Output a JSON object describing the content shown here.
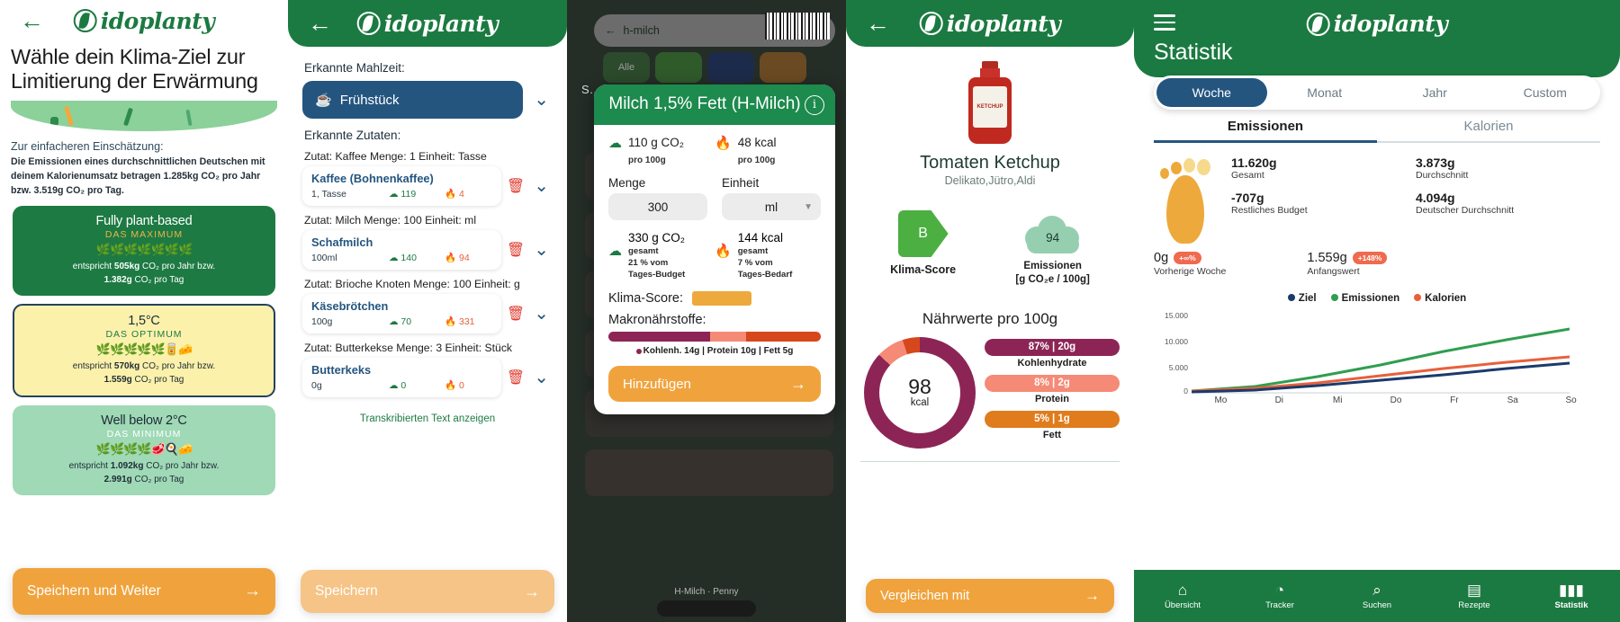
{
  "brand": {
    "name": "idoplanty",
    "leaf_icon": "leaf-circle-icon"
  },
  "panel1": {
    "back_icon": "back-arrow-icon",
    "title": "Wähle dein Klima-Ziel zur Limitierung der Erwärmung",
    "note_head": "Zur einfacheren Einschätzung:",
    "note_body": "Die Emissionen eines durchschnittlichen Deutschen mit deinem Kalorienumsatz betragen 1.285kg CO₂ pro Jahr bzw. 3.519g CO₂ pro Tag.",
    "goals": [
      {
        "title": "Fully plant-based",
        "sub": "DAS MAXIMUM",
        "icons": "🌿🌿🌿🌿🌿🌿🌿",
        "eq_prefix": "entspricht ",
        "eq_year": "505kg",
        "eq_year_suffix": " CO₂ pro Jahr bzw.",
        "eq_day": "1.382g",
        "eq_day_suffix": " CO₂ pro Tag"
      },
      {
        "title": "1,5°C",
        "sub": "DAS OPTIMUM",
        "icons": "🌿🌿🌿🌿🌿🥫🧀",
        "eq_prefix": "entspricht ",
        "eq_year": "570kg",
        "eq_year_suffix": " CO₂ pro Jahr bzw.",
        "eq_day": "1.559g",
        "eq_day_suffix": " CO₂ pro Tag"
      },
      {
        "title": "Well below 2°C",
        "sub": "DAS MINIMUM",
        "icons": "🌿🌿🌿🌿🥩🍳🧀",
        "eq_prefix": "entspricht ",
        "eq_year": "1.092kg",
        "eq_year_suffix": " CO₂ pro Jahr bzw.",
        "eq_day": "2.991g",
        "eq_day_suffix": " CO₂ pro Tag"
      }
    ],
    "cta": "Speichern und Weiter",
    "cta_arrow": "→"
  },
  "panel2": {
    "back_icon": "back-arrow-icon",
    "meal_label": "Erkannte Mahlzeit:",
    "meal_value": "Frühstück",
    "meal_icon": "coffee-icon",
    "ingredients_label": "Erkannte Zutaten:",
    "items": [
      {
        "line": "Zutat: Kaffee  Menge: 1  Einheit: Tasse",
        "name": "Kaffee (Bohnenkaffee)",
        "amount": "1, Tasse",
        "co2": "119",
        "kcal": "4"
      },
      {
        "line": "Zutat: Milch  Menge: 100  Einheit: ml",
        "name": "Schafmilch",
        "amount": "100ml",
        "co2": "140",
        "kcal": "94"
      },
      {
        "line": "Zutat: Brioche Knoten  Menge: 100  Einheit: g",
        "name": "Käsebrötchen",
        "amount": "100g",
        "co2": "70",
        "kcal": "331"
      },
      {
        "line": "Zutat: Butterkekse  Menge: 3  Einheit: Stück",
        "name": "Butterkeks",
        "amount": "0g",
        "co2": "0",
        "kcal": "0"
      }
    ],
    "transcript_link": "Transkribierten Text anzeigen",
    "save": "Speichern",
    "save_arrow": "→"
  },
  "panel3": {
    "search_value": "h-milch",
    "back_icon": "back-arrow-icon",
    "clear_icon": "clear-icon",
    "barcode_icon": "barcode-icon",
    "chip_all": "Alle",
    "bg_word": "S…",
    "modal_title": "Milch 1,5% Fett (H-Milch)",
    "info_icon": "info-icon",
    "per100_co2_value": "110 g CO₂",
    "per100_co2_sub": "pro 100g",
    "per100_kcal_value": "48 kcal",
    "per100_kcal_sub": "pro 100g",
    "menge_label": "Menge",
    "menge_value": "300",
    "einheit_label": "Einheit",
    "einheit_value": "ml",
    "total_co2_value": "330 g CO₂",
    "total_co2_sub": "gesamt\n21 % vom\nTages-Budget",
    "total_kcal_value": "144 kcal",
    "total_kcal_sub": "gesamt\n7 % vom\nTages-Bedarf",
    "score_label": "Klima-Score:",
    "macro_label": "Makronährstoffe:",
    "macro_legend": "Kohlenh. 14g |  Protein 10g |  Fett 5g",
    "macro_parts": [
      {
        "name": "Kohlenhydrate",
        "grams": 14,
        "color": "#8c2556",
        "pct": 48
      },
      {
        "name": "Protein",
        "grams": 10,
        "color": "#f58a76",
        "pct": 17
      },
      {
        "name": "Fett",
        "grams": 5,
        "color": "#d7471c",
        "pct": 35
      }
    ],
    "add_button": "Hinzufügen",
    "add_arrow": "→",
    "list_item_caption": "H-Milch · Penny"
  },
  "panel4": {
    "back_icon": "back-arrow-icon",
    "product_image": "ketchup-bottle-image",
    "product_name": "Tomaten Ketchup",
    "brands": "Delikato,Jütro,Aldi",
    "klima_score_grade": "B",
    "klima_score_label": "Klima-Score",
    "emissions_value": "94",
    "emissions_label": "Emissionen\n[g CO₂e / 100g]",
    "nutrition_title": "Nährwerte pro 100g",
    "kcal_value": "98",
    "kcal_unit": "kcal",
    "macros": [
      {
        "pill": "87% | 20g",
        "caption": "Kohlenhydrate",
        "color": "#8c2556",
        "pct": 87
      },
      {
        "pill": "8% | 2g",
        "caption": "Protein",
        "color": "#f58a76",
        "pct": 8
      },
      {
        "pill": "5% | 1g",
        "caption": "Fett",
        "color": "#e07c1c",
        "pct": 5
      }
    ],
    "compare_button": "Vergleichen mit",
    "compare_arrow": "→"
  },
  "panel5": {
    "menu_icon": "hamburger-icon",
    "title": "Statistik",
    "segments": [
      "Woche",
      "Monat",
      "Jahr",
      "Custom"
    ],
    "segment_active": "Woche",
    "tabs": [
      "Emissionen",
      "Kalorien"
    ],
    "tab_active": "Emissionen",
    "footprint_icon": "footprint-icon",
    "stats": [
      {
        "value": "11.620g",
        "caption": "Gesamt"
      },
      {
        "value": "3.873g",
        "caption": "Durchschnitt"
      },
      {
        "value": "-707g",
        "caption": "Restliches Budget"
      },
      {
        "value": "4.094g",
        "caption": "Deutscher Durchschnitt"
      }
    ],
    "previous": [
      {
        "value": "0g",
        "badge": "+∞%",
        "caption": "Vorherige Woche"
      },
      {
        "value": "1.559g",
        "badge": "+148%",
        "caption": "Anfangswert"
      }
    ],
    "legend": [
      {
        "label": "Ziel",
        "color": "#1b3a6b"
      },
      {
        "label": "Emissionen",
        "color": "#2f9e4f"
      },
      {
        "label": "Kalorien",
        "color": "#e8603c"
      }
    ],
    "nav": [
      {
        "label": "Übersicht",
        "icon": "home-icon"
      },
      {
        "label": "Tracker",
        "icon": "tracker-icon"
      },
      {
        "label": "Suchen",
        "icon": "search-icon"
      },
      {
        "label": "Rezepte",
        "icon": "recipe-icon"
      },
      {
        "label": "Statistik",
        "icon": "chart-icon"
      }
    ],
    "nav_active": "Statistik"
  },
  "chart_data": {
    "type": "line",
    "title": "",
    "xlabel": "",
    "ylabel": "",
    "x": [
      "Mo",
      "Di",
      "Mi",
      "Do",
      "Fr",
      "Sa",
      "So"
    ],
    "ylim": [
      0,
      15000
    ],
    "yticks": [
      0,
      5000,
      10000,
      15000
    ],
    "ytick_labels": [
      "0",
      "5.000",
      "10.000",
      "15.000"
    ],
    "grid": false,
    "legend_position": "top",
    "series": [
      {
        "name": "Ziel",
        "color": "#1b3a6b",
        "values": [
          300,
          700,
          1400,
          2300,
          3300,
          4400,
          5400
        ]
      },
      {
        "name": "Emissionen",
        "color": "#2f9e4f",
        "values": [
          400,
          1300,
          3000,
          5200,
          7600,
          9700,
          11620
        ]
      },
      {
        "name": "Kalorien",
        "color": "#e8603c",
        "values": [
          350,
          900,
          1900,
          3100,
          4400,
          5600,
          6600
        ]
      }
    ]
  }
}
